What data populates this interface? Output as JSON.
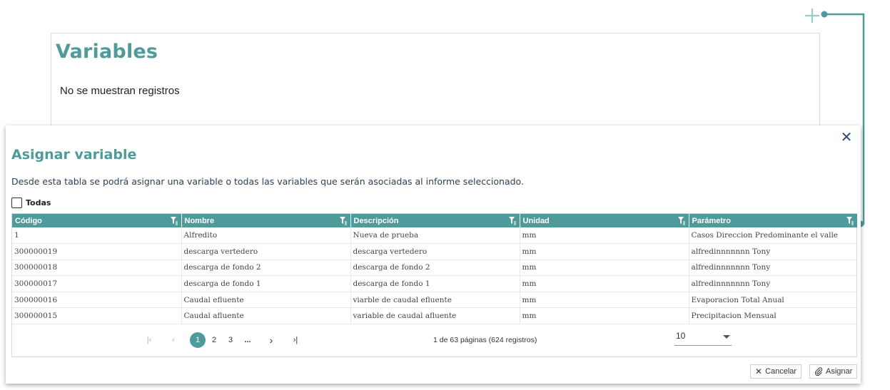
{
  "page": {
    "title": "Variables",
    "empty_message": "No se muestran registros"
  },
  "modal": {
    "title": "Asignar variable",
    "description": "Desde esta tabla se podrá asignar una variable o todas las variables que serán asociadas al informe seleccionado.",
    "close_symbol": "✕",
    "select_all_label": "Todas",
    "cancel_label": "Cancelar",
    "assign_label": "Asignar"
  },
  "table": {
    "columns": [
      "Código",
      "Nombre",
      "Descripción",
      "Unidad",
      "Parámetro"
    ],
    "rows": [
      [
        "1",
        "Alfredito",
        "Nueva de prueba",
        "mm",
        "Casos Direccion Predominante el valle"
      ],
      [
        "300000019",
        "descarga vertedero",
        "descarga vertedero",
        "mm",
        "alfredinnnnnnn Tony"
      ],
      [
        "300000018",
        "descarga de fondo 2",
        "descarga de fondo 2",
        "mm",
        "alfredinnnnnnn Tony"
      ],
      [
        "300000017",
        "descarga de fondo 1",
        "descarga de fondo 1",
        "mm",
        "alfredinnnnnnn Tony"
      ],
      [
        "300000016",
        "Caudal efluente",
        "viarble de caudal efluente",
        "mm",
        "Evaporacion Total Anual"
      ],
      [
        "300000015",
        "Caudal afluente",
        "variable de caudal afluente",
        "mm",
        "Precipitacion Mensual"
      ]
    ]
  },
  "pagination": {
    "first": "|‹",
    "prev": "‹",
    "pages": [
      "1",
      "2",
      "3"
    ],
    "ellipsis": "...",
    "next": "›",
    "last": "›|",
    "current_page": "1",
    "info": "1 de 63 páginas (624 registros)",
    "page_size": "10"
  },
  "colors": {
    "accent": "#4f9a9b",
    "text_dark": "#2b3e55"
  }
}
